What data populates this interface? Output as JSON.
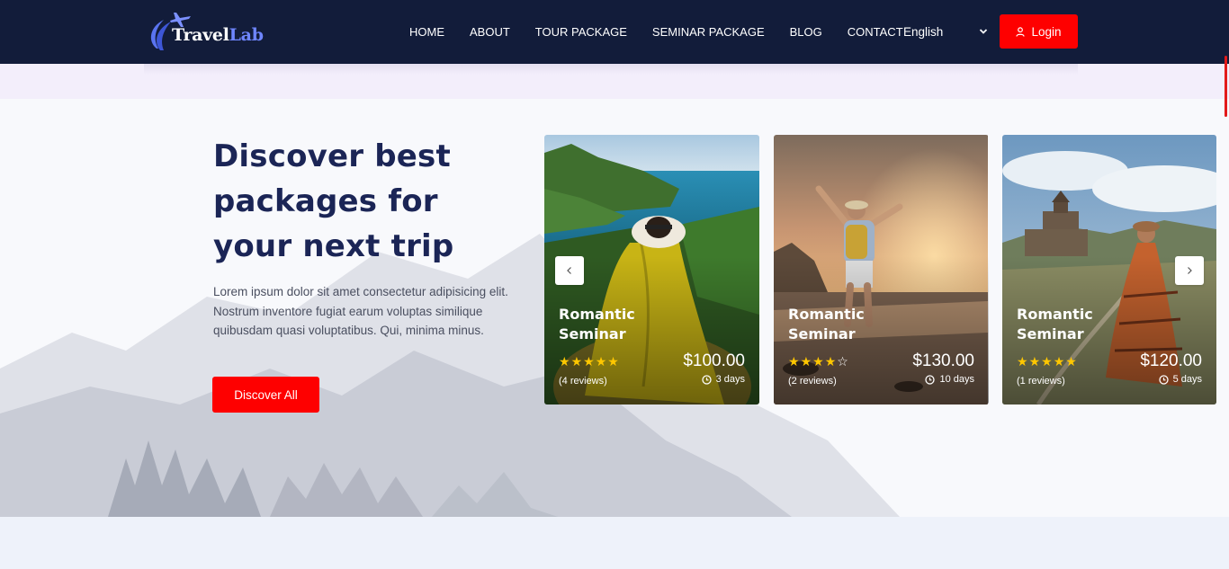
{
  "header": {
    "logo": {
      "part1": "Travel",
      "part2": "Lab"
    },
    "nav": [
      "HOME",
      "ABOUT",
      "TOUR PACKAGE",
      "SEMINAR PACKAGE",
      "BLOG",
      "CONTACT"
    ],
    "language": "English",
    "login_label": "Login"
  },
  "hero": {
    "headline": "Discover best packages for your next trip",
    "description": "Lorem ipsum dolor sit amet consectetur adipisicing elit. Nostrum inventore fugiat earum voluptas similique quibusdam quasi voluptatibus. Qui, minima minus.",
    "cta_label": "Discover All"
  },
  "cards": [
    {
      "title": "Romantic Seminar",
      "rating": 5,
      "reviews": "(4 reviews)",
      "price": "$100.00",
      "duration": "3 days"
    },
    {
      "title": "Romantic Seminar",
      "rating": 4,
      "reviews": "(2 reviews)",
      "price": "$130.00",
      "duration": "10 days"
    },
    {
      "title": "Romantic Seminar",
      "rating": 5,
      "reviews": "(1 reviews)",
      "price": "$120.00",
      "duration": "5 days"
    }
  ],
  "icons": {
    "logo": "plane-swoosh-icon",
    "login": "user-icon",
    "language": "chevron-down-icon",
    "prev": "chevron-left-icon",
    "next": "chevron-right-icon",
    "duration": "clock-icon",
    "rating": "star-icon"
  },
  "colors": {
    "header_bg": "#121c3a",
    "accent": "#fe0000",
    "headline": "#1b2556",
    "star": "#ffc700",
    "logo_accent": "#6f86ff"
  }
}
